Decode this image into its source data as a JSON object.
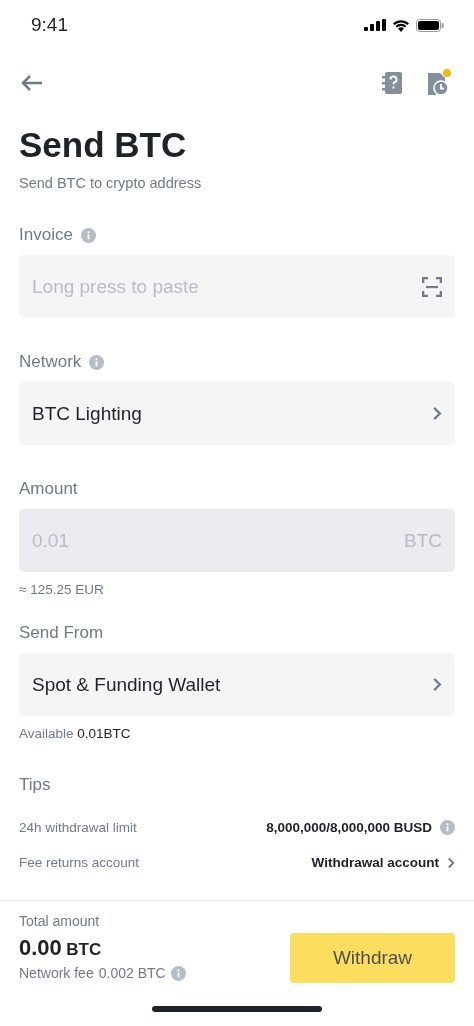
{
  "status_bar": {
    "time": "9:41"
  },
  "header": {
    "history_badge": true
  },
  "title": "Send BTC",
  "subtitle": "Send BTC to crypto address",
  "fields": [
    {
      "kind": "input",
      "label": "Invoice",
      "info": true,
      "placeholder": "Long press to paste"
    },
    {
      "kind": "select",
      "label": "Network",
      "info": true,
      "value": "BTC Lighting"
    },
    {
      "kind": "amount",
      "label": "Amount",
      "info": false,
      "value": "0.01",
      "unit": "BTC",
      "disabled": true,
      "note": "≈ 125.25 EUR"
    },
    {
      "kind": "select",
      "label": "Send From",
      "info": false,
      "value": "Spot & Funding Wallet",
      "note_label": "Available",
      "note_value": "0.01BTC"
    }
  ],
  "tips": {
    "title": "Tips",
    "rows": [
      {
        "kind": "info",
        "label": "24h withdrawal limit",
        "value": "8,000,000/8,000,000 BUSD"
      },
      {
        "kind": "link",
        "label": "Fee returns account",
        "value": "Withdrawal account"
      }
    ]
  },
  "footer": {
    "total_label": "Total amount",
    "total_value": "0.00",
    "total_unit": "BTC",
    "fee_label": "Network fee",
    "fee_value": "0.002 BTC",
    "button": "Withdraw"
  }
}
